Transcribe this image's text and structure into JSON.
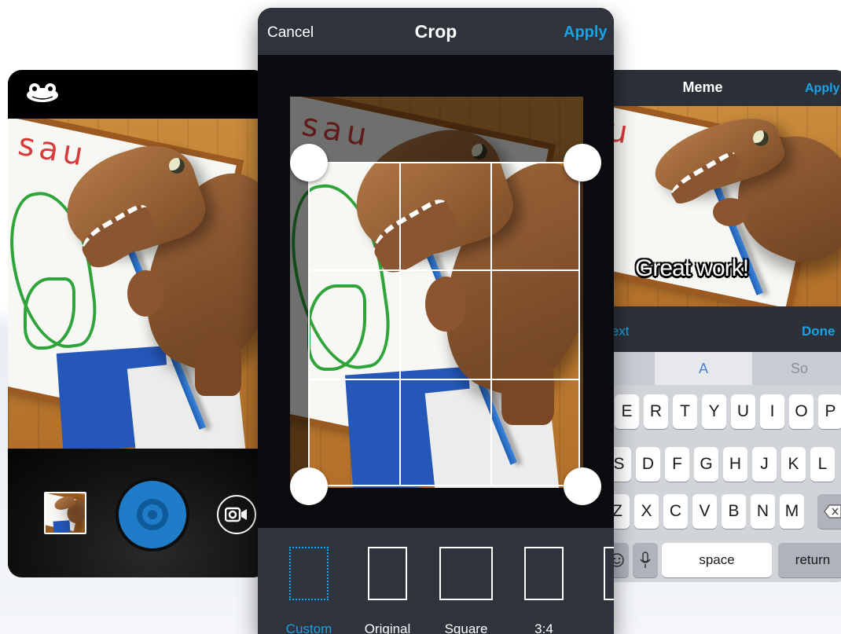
{
  "camera": {
    "logo_icon": "frog-icon",
    "shutter_icon": "shutter-button-icon",
    "mode_icon": "video-camera-icon"
  },
  "crop": {
    "cancel_label": "Cancel",
    "title": "Crop",
    "apply_label": "Apply",
    "ratios": [
      {
        "label": "Custom",
        "selected": true
      },
      {
        "label": "Original",
        "selected": false
      },
      {
        "label": "Square",
        "selected": false
      },
      {
        "label": "3:4",
        "selected": false
      }
    ],
    "accent_color": "#1aa2e6"
  },
  "meme": {
    "title": "Meme",
    "apply_label": "Apply",
    "caption": "Great work!",
    "next_label": "Next",
    "next_visible": "lext",
    "done_label": "Done",
    "suggestions": [
      "A",
      "So"
    ],
    "keyboard": {
      "row1": [
        "E",
        "R",
        "T",
        "Y",
        "U",
        "I",
        "O",
        "P"
      ],
      "row2": [
        "S",
        "D",
        "F",
        "G",
        "H",
        "J",
        "K",
        "L"
      ],
      "row3": [
        "Z",
        "X",
        "C",
        "V",
        "B",
        "N",
        "M"
      ],
      "space_label": "space",
      "return_label": "return"
    }
  }
}
